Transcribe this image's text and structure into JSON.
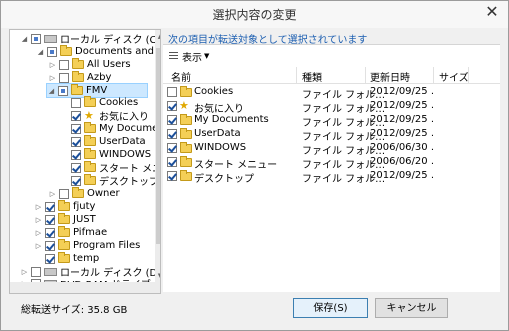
{
  "window": {
    "title": "選択内容の変更",
    "close_glyph": "✕"
  },
  "tree": {
    "items": [
      {
        "label": "ローカル ディスク (C:)"
      },
      {
        "label": "Documents and Se"
      },
      {
        "label": "All Users"
      },
      {
        "label": "Azby"
      },
      {
        "label": "FMV"
      },
      {
        "label": "Cookies"
      },
      {
        "label": "お気に入り"
      },
      {
        "label": "My Docume"
      },
      {
        "label": "UserData"
      },
      {
        "label": "WINDOWS"
      },
      {
        "label": "スタート メニュ"
      },
      {
        "label": "デスクトップ"
      },
      {
        "label": "Owner"
      },
      {
        "label": "fjuty"
      },
      {
        "label": "JUST"
      },
      {
        "label": "Pifmae"
      },
      {
        "label": "Program Files"
      },
      {
        "label": "temp"
      },
      {
        "label": "ローカル ディスク (D:)"
      },
      {
        "label": "DVD-RAM ドライブ (E:"
      }
    ]
  },
  "hint": "次の項目が転送対象として選択されています",
  "toolbar": {
    "view_label": "表示"
  },
  "columns": {
    "name": "名前",
    "type": "種類",
    "date": "更新日時",
    "size": "サイズ"
  },
  "rows": [
    {
      "name": "Cookies",
      "type": "ファイル フォル…",
      "date": "2012/09/25 ."
    },
    {
      "name": "お気に入り",
      "type": "ファイル フォル…",
      "date": "2012/09/25 ."
    },
    {
      "name": "My Documents",
      "type": "ファイル フォル…",
      "date": "2012/09/25 ."
    },
    {
      "name": "UserData",
      "type": "ファイル フォル…",
      "date": "2012/09/25 ."
    },
    {
      "name": "WINDOWS",
      "type": "ファイル フォル…",
      "date": "2006/06/30 ."
    },
    {
      "name": "スタート メニュー",
      "type": "ファイル フォル…",
      "date": "2006/06/20 ."
    },
    {
      "name": "デスクトップ",
      "type": "ファイル フォル…",
      "date": "2012/09/25 ."
    }
  ],
  "footer": {
    "total": "総転送サイズ: 35.8 GB",
    "save": "保存(S)",
    "cancel": "キャンセル"
  }
}
